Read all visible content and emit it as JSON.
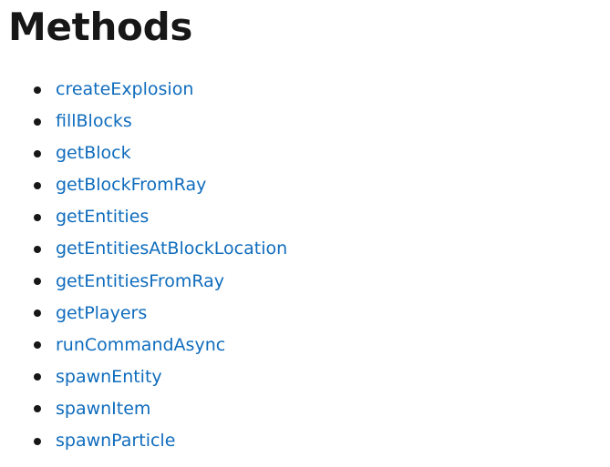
{
  "heading": "Methods",
  "colors": {
    "heading": "#171717",
    "link": "#0f6cbd",
    "bullet": "#171717",
    "background": "#ffffff"
  },
  "methods": [
    "createExplosion",
    "fillBlocks",
    "getBlock",
    "getBlockFromRay",
    "getEntities",
    "getEntitiesAtBlockLocation",
    "getEntitiesFromRay",
    "getPlayers",
    "runCommandAsync",
    "spawnEntity",
    "spawnItem",
    "spawnParticle"
  ]
}
